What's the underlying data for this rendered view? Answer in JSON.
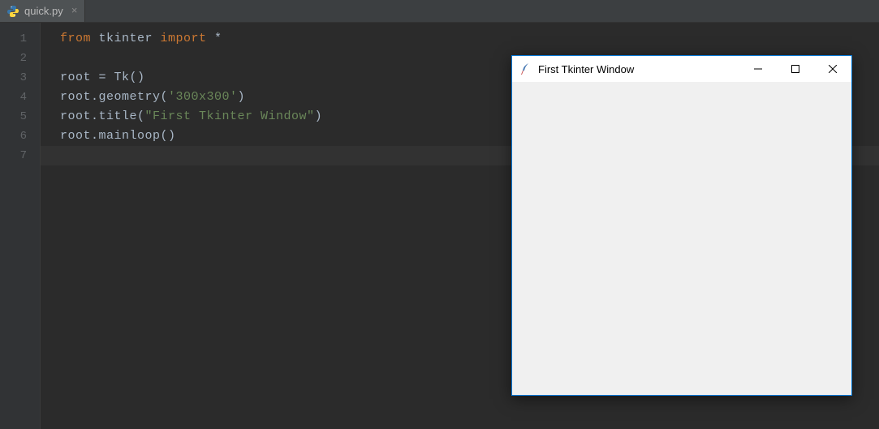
{
  "tab": {
    "filename": "quick.py",
    "close_glyph": "×"
  },
  "gutter": {
    "lines": [
      "1",
      "2",
      "3",
      "4",
      "5",
      "6",
      "7"
    ]
  },
  "code": {
    "l1_from": "from",
    "l1_tkinter": " tkinter ",
    "l1_import": "import",
    "l1_star": " *",
    "l3_root": "root ",
    "l3_eq": "= ",
    "l3_tk": "Tk()",
    "l4": "root.geometry(",
    "l4_str": "'300x300'",
    "l4_close": ")",
    "l5": "root.title(",
    "l5_str": "\"First Tkinter Window\"",
    "l5_close": ")",
    "l6": "root.mainloop()"
  },
  "tkwin": {
    "title": "First Tkinter Window"
  }
}
